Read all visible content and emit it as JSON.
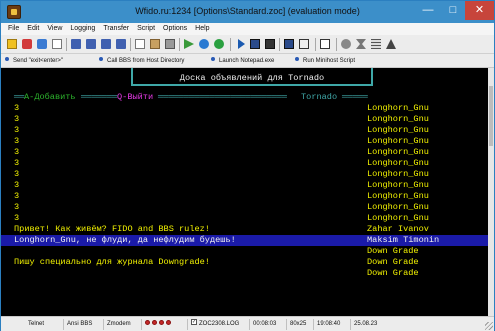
{
  "window": {
    "title": "Wfido.ru:1234 [Options\\Standard.zoc] (evaluation mode)",
    "controls": {
      "minimize": "—",
      "maximize": "□",
      "close": "✕"
    }
  },
  "menu": [
    "File",
    "Edit",
    "View",
    "Logging",
    "Transfer",
    "Script",
    "Options",
    "Help"
  ],
  "toolbar": {
    "icons": [
      "open-icon",
      "connect-icon",
      "disconnect-icon",
      "new-icon",
      "send-icon",
      "receive-icon",
      "upload-icon",
      "download-icon",
      "copy-icon",
      "paste-icon",
      "print-icon",
      "play-icon",
      "record-icon",
      "stop-icon",
      "script-icon",
      "log-icon",
      "capture-icon",
      "screen-icon",
      "window-icon",
      "tab-icon",
      "settings-icon",
      "tools-icon",
      "grid-icon",
      "help-icon"
    ]
  },
  "buttonbar": {
    "items": [
      "Send \"exit<enter>\"",
      "Call BBS from Host Directory",
      "Launch Notepad.exe",
      "Run Minihost Script"
    ]
  },
  "terminal": {
    "header_title": "Доска объявлений для Tornado",
    "add_label": "A-Добавить",
    "quit_label": "Q-Выйти",
    "section_label": "Tornado",
    "rows": [
      {
        "text": "3",
        "author": "Longhorn_Gnu",
        "color": "yellow"
      },
      {
        "text": "3",
        "author": "Longhorn_Gnu",
        "color": "yellow"
      },
      {
        "text": "3",
        "author": "Longhorn_Gnu",
        "color": "yellow"
      },
      {
        "text": "3",
        "author": "Longhorn_Gnu",
        "color": "yellow"
      },
      {
        "text": "3",
        "author": "Longhorn_Gnu",
        "color": "yellow"
      },
      {
        "text": "3",
        "author": "Longhorn_Gnu",
        "color": "yellow"
      },
      {
        "text": "3",
        "author": "Longhorn_Gnu",
        "color": "yellow"
      },
      {
        "text": "3",
        "author": "Longhorn_Gnu",
        "color": "yellow"
      },
      {
        "text": "3",
        "author": "Longhorn_Gnu",
        "color": "yellow"
      },
      {
        "text": "3",
        "author": "Longhorn_Gnu",
        "color": "yellow"
      },
      {
        "text": "3",
        "author": "Longhorn_Gnu",
        "color": "yellow"
      },
      {
        "text": "Привет! Как живём? FIDO and BBS rulez!",
        "author": "Zahar Ivanov",
        "color": "yellow"
      },
      {
        "text": "Longhorn_Gnu, не флуди, да нефлудим будешь!",
        "author": "Maksim Timonin",
        "color": "white",
        "selected": true
      },
      {
        "text": "",
        "author": "Down Grade",
        "color": "yellow"
      },
      {
        "text": "Пишу специально для журнала Downgrade!",
        "author": "Down Grade",
        "color": "yellow"
      },
      {
        "text": "",
        "author": "Down Grade",
        "color": "yellow"
      }
    ]
  },
  "status": {
    "terminal": "Telnet",
    "emulation": "Ansi BBS",
    "transfer": "Zmodem",
    "log": "ZOC2308.LOG",
    "online_time": "00:08:03",
    "size": "80x25",
    "clock": "19:08:40",
    "date": "25.08.23"
  },
  "colors": {
    "titlebar": "#3c8fc9",
    "terminal_bg": "#000000",
    "text_yellow": "#f2f200",
    "text_green": "#2db52d",
    "text_magenta": "#e83ae8",
    "text_cyan": "#3fa8a8",
    "selection": "#1a1aa8",
    "close_button": "#c7453b"
  }
}
